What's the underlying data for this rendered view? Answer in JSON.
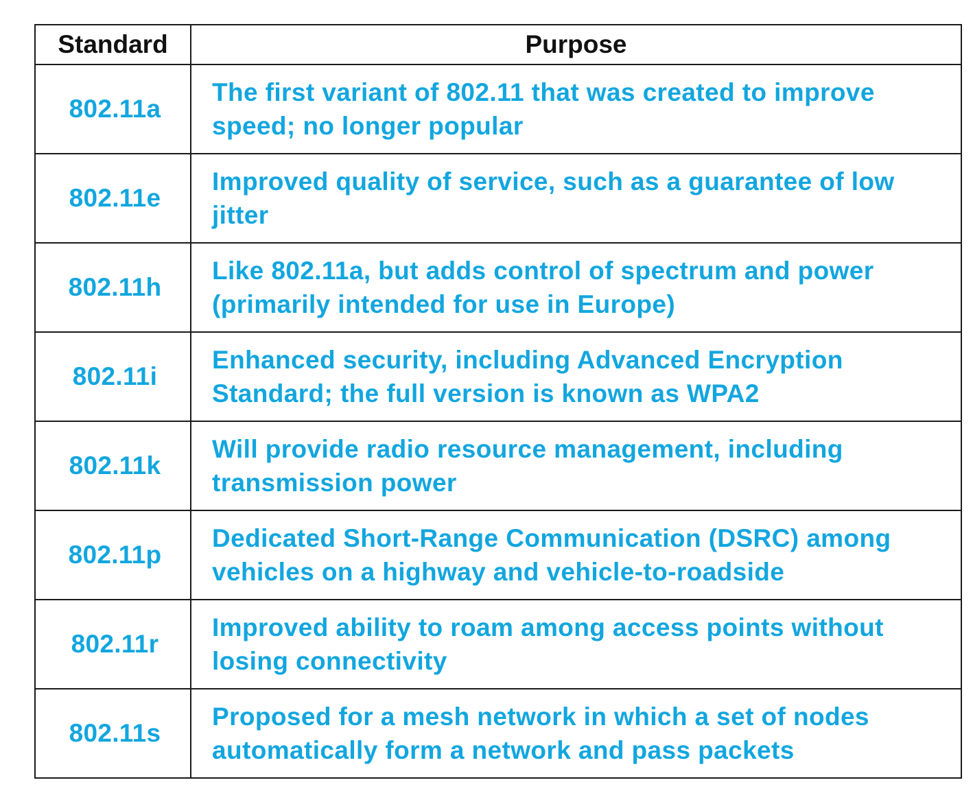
{
  "table": {
    "headers": {
      "standard": "Standard",
      "purpose": "Purpose"
    },
    "rows": [
      {
        "standard": "802.11a",
        "purpose": "The first variant of 802.11 that was created to improve speed; no longer popular"
      },
      {
        "standard": "802.11e",
        "purpose": "Improved quality of service, such as a guarantee of low jitter"
      },
      {
        "standard": "802.11h",
        "purpose": "Like 802.11a, but adds control of spectrum and power (primarily intended for use in Europe)"
      },
      {
        "standard": "802.11i",
        "purpose": "Enhanced security, including Advanced Encryption Standard; the full version is known as WPA2"
      },
      {
        "standard": "802.11k",
        "purpose": "Will provide radio resource management, including transmission power"
      },
      {
        "standard": "802.11p",
        "purpose": "Dedicated Short-Range Communication (DSRC) among vehicles on a highway and vehicle-to-roadside"
      },
      {
        "standard": "802.11r",
        "purpose": "Improved ability to roam among access points without losing connectivity"
      },
      {
        "standard": "802.11s",
        "purpose": "Proposed for a mesh network in which a set of nodes automatically form a network and pass packets"
      }
    ]
  },
  "colors": {
    "text_blue": "#12a6df",
    "header_text": "#111111",
    "border": "#1a1a1a"
  }
}
